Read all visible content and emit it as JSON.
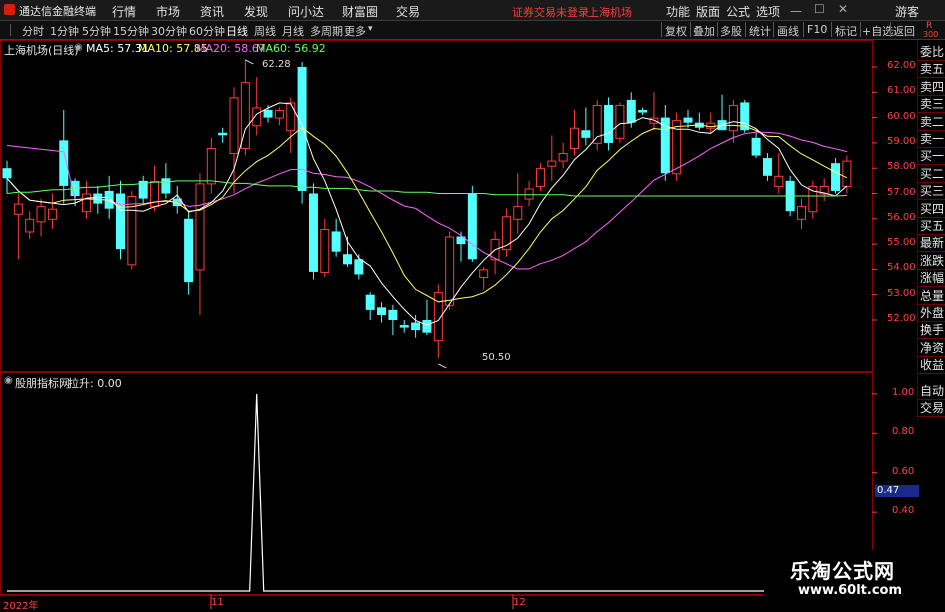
{
  "app": {
    "title": "通达信金融终端",
    "menu": [
      "行情",
      "市场",
      "资讯",
      "发现",
      "问小达",
      "财富圈",
      "交易"
    ],
    "alert": "证券交易未登录",
    "alert_stock": "上海机场",
    "menu_right": [
      "功能",
      "版面",
      "公式",
      "选项"
    ],
    "guest": "游客"
  },
  "period_bar": {
    "periods": [
      "分时",
      "1分钟",
      "5分钟",
      "15分钟",
      "30分钟",
      "60分钟",
      "日线",
      "周线",
      "月线",
      "多周期",
      "更多"
    ],
    "active": "日线",
    "tools": [
      "复权",
      "叠加",
      "多股",
      "统计",
      "画线",
      "F10",
      "标记",
      "+自选",
      "返回"
    ]
  },
  "right_panel": {
    "top_badge": "R",
    "top_num": "300",
    "items": [
      "委比",
      "卖五",
      "卖四",
      "卖三",
      "卖二",
      "卖一",
      "买一",
      "买二",
      "买三",
      "买四",
      "买五",
      "最新",
      "涨跌",
      "涨幅",
      "总量",
      "外盘",
      "换手",
      "净资",
      "收益",
      "自动",
      "交易"
    ]
  },
  "main_panel": {
    "stock": "上海机场(日线)",
    "ma": [
      {
        "label": "MA5: 57.31",
        "color": "#ffffff"
      },
      {
        "label": "MA10: 57.85",
        "color": "#ffff66"
      },
      {
        "label": "MA20: 58.67",
        "color": "#ff66ff"
      },
      {
        "label": "MA60: 56.92",
        "color": "#66ff66"
      }
    ],
    "high_mark": "62.28",
    "low_mark": "50.50",
    "price_axis": [
      "62.00",
      "61.00",
      "60.00",
      "59.00",
      "58.00",
      "57.00",
      "56.00",
      "55.00",
      "54.00",
      "53.00",
      "52.00"
    ]
  },
  "sub_panel": {
    "title": "股朋指标网",
    "indicator": "拉升: 0.00",
    "axis": [
      "1.00",
      "0.80",
      "0.60",
      "0.40"
    ],
    "current_value": "0.47"
  },
  "date_axis": [
    "2022年",
    "11",
    "12"
  ],
  "watermark": {
    "line1": "乐淘公式网",
    "line2": "www.60lt.com"
  },
  "chart_data": {
    "type": "candlestick",
    "title": "上海机场(日线)",
    "ylim": [
      50.5,
      62.5
    ],
    "up_color": "#ff3b3b",
    "down_color": "#54ffff",
    "candles": [
      {
        "o": 58.0,
        "h": 58.3,
        "l": 57.0,
        "c": 57.6
      },
      {
        "o": 56.2,
        "h": 57.0,
        "l": 54.4,
        "c": 56.6
      },
      {
        "o": 55.5,
        "h": 56.3,
        "l": 55.2,
        "c": 56.0
      },
      {
        "o": 55.9,
        "h": 56.8,
        "l": 55.3,
        "c": 56.5
      },
      {
        "o": 56.0,
        "h": 57.0,
        "l": 55.6,
        "c": 56.4
      },
      {
        "o": 59.1,
        "h": 60.3,
        "l": 56.6,
        "c": 57.3
      },
      {
        "o": 57.5,
        "h": 57.6,
        "l": 56.5,
        "c": 56.9
      },
      {
        "o": 56.3,
        "h": 57.5,
        "l": 56.0,
        "c": 57.0
      },
      {
        "o": 57.0,
        "h": 57.3,
        "l": 56.2,
        "c": 56.6
      },
      {
        "o": 57.1,
        "h": 57.7,
        "l": 56.0,
        "c": 56.4
      },
      {
        "o": 57.0,
        "h": 57.5,
        "l": 54.4,
        "c": 54.8
      },
      {
        "o": 54.2,
        "h": 57.1,
        "l": 54.0,
        "c": 56.9
      },
      {
        "o": 57.5,
        "h": 57.7,
        "l": 56.6,
        "c": 56.8
      },
      {
        "o": 56.5,
        "h": 58.1,
        "l": 56.3,
        "c": 57.5
      },
      {
        "o": 57.6,
        "h": 58.2,
        "l": 56.8,
        "c": 57.0
      },
      {
        "o": 56.8,
        "h": 57.3,
        "l": 56.2,
        "c": 56.5
      },
      {
        "o": 56.0,
        "h": 56.3,
        "l": 53.0,
        "c": 53.5
      },
      {
        "o": 54.0,
        "h": 57.8,
        "l": 52.2,
        "c": 57.4
      },
      {
        "o": 57.4,
        "h": 59.2,
        "l": 57.0,
        "c": 58.8
      },
      {
        "o": 59.4,
        "h": 59.6,
        "l": 59.0,
        "c": 59.3
      },
      {
        "o": 58.6,
        "h": 61.2,
        "l": 57.0,
        "c": 60.8
      },
      {
        "o": 58.8,
        "h": 62.3,
        "l": 58.5,
        "c": 61.4
      },
      {
        "o": 59.7,
        "h": 61.6,
        "l": 59.3,
        "c": 60.4
      },
      {
        "o": 60.3,
        "h": 60.5,
        "l": 59.8,
        "c": 60.0
      },
      {
        "o": 60.0,
        "h": 60.4,
        "l": 59.7,
        "c": 60.3
      },
      {
        "o": 59.5,
        "h": 60.8,
        "l": 58.6,
        "c": 60.6
      },
      {
        "o": 62.0,
        "h": 62.2,
        "l": 56.6,
        "c": 57.1
      },
      {
        "o": 57.0,
        "h": 57.4,
        "l": 53.6,
        "c": 53.9
      },
      {
        "o": 53.9,
        "h": 56.0,
        "l": 53.7,
        "c": 55.6
      },
      {
        "o": 55.5,
        "h": 56.0,
        "l": 54.5,
        "c": 54.7
      },
      {
        "o": 54.6,
        "h": 55.3,
        "l": 54.1,
        "c": 54.2
      },
      {
        "o": 54.4,
        "h": 54.6,
        "l": 53.6,
        "c": 53.8
      },
      {
        "o": 53.0,
        "h": 53.1,
        "l": 52.0,
        "c": 52.4
      },
      {
        "o": 52.5,
        "h": 52.7,
        "l": 51.9,
        "c": 52.2
      },
      {
        "o": 52.4,
        "h": 52.6,
        "l": 51.4,
        "c": 52.0
      },
      {
        "o": 51.8,
        "h": 52.0,
        "l": 51.5,
        "c": 51.7
      },
      {
        "o": 51.9,
        "h": 52.2,
        "l": 51.3,
        "c": 51.6
      },
      {
        "o": 52.0,
        "h": 52.8,
        "l": 51.4,
        "c": 51.5
      },
      {
        "o": 51.2,
        "h": 53.4,
        "l": 50.5,
        "c": 53.1
      },
      {
        "o": 52.6,
        "h": 55.5,
        "l": 52.4,
        "c": 55.3
      },
      {
        "o": 55.3,
        "h": 55.5,
        "l": 54.3,
        "c": 55.0
      },
      {
        "o": 57.0,
        "h": 57.3,
        "l": 54.3,
        "c": 54.4
      },
      {
        "o": 53.7,
        "h": 54.1,
        "l": 53.2,
        "c": 54.0
      },
      {
        "o": 54.4,
        "h": 55.5,
        "l": 53.8,
        "c": 55.2
      },
      {
        "o": 54.8,
        "h": 56.4,
        "l": 54.5,
        "c": 56.1
      },
      {
        "o": 56.0,
        "h": 57.8,
        "l": 55.4,
        "c": 56.5
      },
      {
        "o": 56.8,
        "h": 57.5,
        "l": 56.5,
        "c": 57.2
      },
      {
        "o": 57.3,
        "h": 58.2,
        "l": 57.1,
        "c": 58.0
      },
      {
        "o": 58.1,
        "h": 59.3,
        "l": 57.5,
        "c": 58.3
      },
      {
        "o": 58.3,
        "h": 59.0,
        "l": 58.0,
        "c": 58.6
      },
      {
        "o": 58.8,
        "h": 60.3,
        "l": 58.5,
        "c": 59.6
      },
      {
        "o": 59.5,
        "h": 60.4,
        "l": 58.9,
        "c": 59.2
      },
      {
        "o": 59.0,
        "h": 60.7,
        "l": 58.7,
        "c": 60.5
      },
      {
        "o": 60.5,
        "h": 60.8,
        "l": 58.7,
        "c": 59.0
      },
      {
        "o": 59.2,
        "h": 60.6,
        "l": 59.0,
        "c": 60.5
      },
      {
        "o": 60.7,
        "h": 61.0,
        "l": 59.6,
        "c": 59.8
      },
      {
        "o": 60.3,
        "h": 60.4,
        "l": 60.1,
        "c": 60.2
      },
      {
        "o": 59.8,
        "h": 61.0,
        "l": 59.5,
        "c": 60.0
      },
      {
        "o": 60.0,
        "h": 60.5,
        "l": 57.5,
        "c": 57.8
      },
      {
        "o": 57.8,
        "h": 60.2,
        "l": 57.5,
        "c": 59.9
      },
      {
        "o": 60.0,
        "h": 60.3,
        "l": 59.6,
        "c": 59.8
      },
      {
        "o": 59.8,
        "h": 60.2,
        "l": 59.5,
        "c": 59.6
      },
      {
        "o": 59.6,
        "h": 60.2,
        "l": 59.4,
        "c": 59.8
      },
      {
        "o": 59.9,
        "h": 60.9,
        "l": 59.5,
        "c": 59.5
      },
      {
        "o": 59.5,
        "h": 60.7,
        "l": 59.0,
        "c": 60.5
      },
      {
        "o": 60.6,
        "h": 60.7,
        "l": 59.4,
        "c": 59.5
      },
      {
        "o": 59.2,
        "h": 59.4,
        "l": 58.4,
        "c": 58.5
      },
      {
        "o": 58.4,
        "h": 58.6,
        "l": 57.5,
        "c": 57.7
      },
      {
        "o": 57.3,
        "h": 58.6,
        "l": 57.0,
        "c": 57.7
      },
      {
        "o": 57.5,
        "h": 57.7,
        "l": 56.1,
        "c": 56.3
      },
      {
        "o": 56.0,
        "h": 56.8,
        "l": 55.6,
        "c": 56.5
      },
      {
        "o": 56.3,
        "h": 57.5,
        "l": 56.0,
        "c": 57.3
      },
      {
        "o": 57.0,
        "h": 57.6,
        "l": 56.7,
        "c": 57.3
      },
      {
        "o": 58.2,
        "h": 58.4,
        "l": 57.0,
        "c": 57.1
      },
      {
        "o": 57.3,
        "h": 58.5,
        "l": 57.0,
        "c": 58.3
      }
    ],
    "ma60": [
      57.0,
      57.05,
      57.1,
      57.15,
      57.2,
      57.25,
      57.3,
      57.35,
      57.4,
      57.45,
      57.5,
      57.5,
      57.5,
      57.45,
      57.4,
      57.35,
      57.3,
      57.3,
      57.25,
      57.2,
      57.2,
      57.15,
      57.1,
      57.1,
      57.05,
      57.05,
      57.0,
      57.0,
      57.0,
      56.95,
      56.95,
      56.95,
      56.95,
      56.95,
      56.9,
      56.9,
      56.9,
      56.9,
      56.9,
      56.9,
      56.9,
      56.9,
      56.9,
      56.9,
      56.9,
      56.9,
      56.9,
      56.9,
      56.9,
      56.9,
      56.92
    ]
  },
  "sub_chart": {
    "type": "line",
    "ylim": [
      0,
      1.05
    ],
    "spike_index": 22,
    "spike_value": 1.0,
    "count": 78
  }
}
